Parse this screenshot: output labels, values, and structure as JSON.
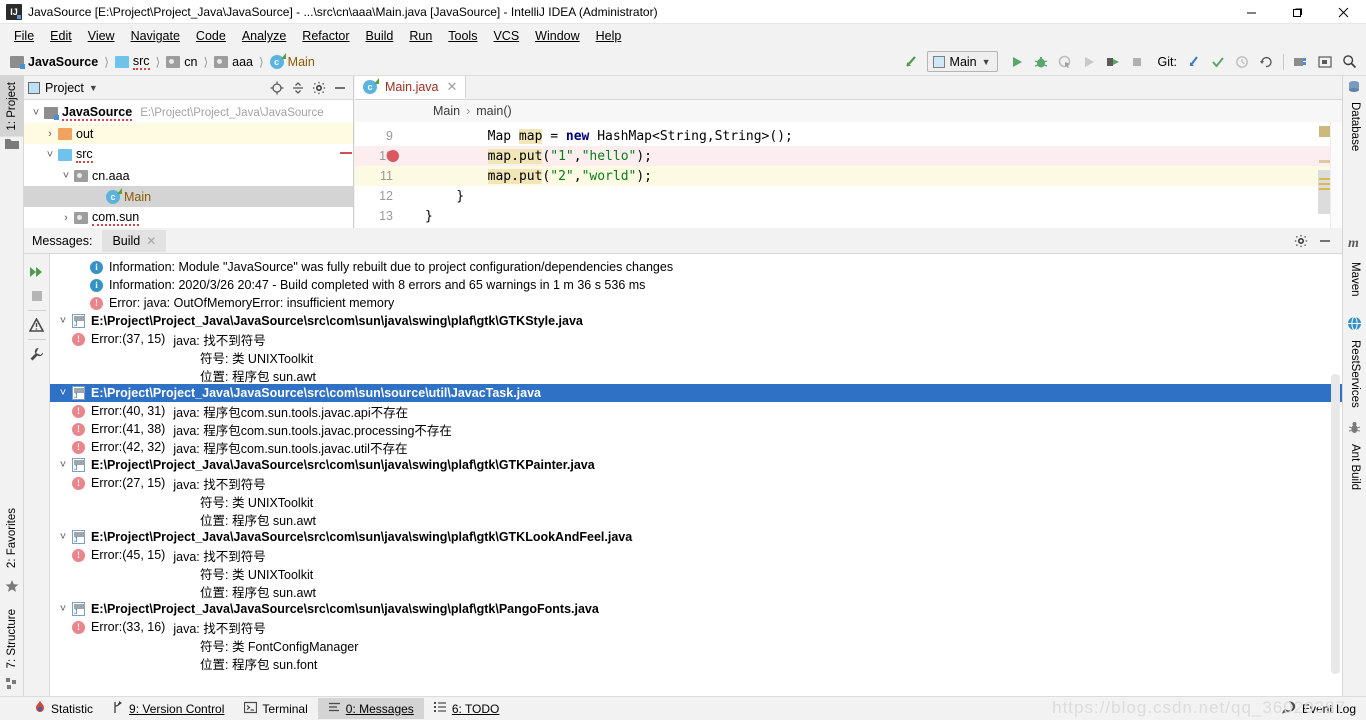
{
  "window": {
    "title": "JavaSource [E:\\Project\\Project_Java\\JavaSource] - ...\\src\\cn\\aaa\\Main.java [JavaSource] - IntelliJ IDEA (Administrator)",
    "app_icon": "IJ",
    "minimize": "minimize-icon",
    "maximize": "restore-icon",
    "close": "close-icon"
  },
  "menu": [
    {
      "label": "File"
    },
    {
      "label": "Edit"
    },
    {
      "label": "View"
    },
    {
      "label": "Navigate"
    },
    {
      "label": "Code"
    },
    {
      "label": "Analyze"
    },
    {
      "label": "Refactor"
    },
    {
      "label": "Build"
    },
    {
      "label": "Run"
    },
    {
      "label": "Tools"
    },
    {
      "label": "VCS"
    },
    {
      "label": "Window"
    },
    {
      "label": "Help"
    }
  ],
  "breadcrumbs": [
    {
      "label": "JavaSource",
      "icon": "module-icon"
    },
    {
      "label": "src",
      "icon": "source-folder-icon"
    },
    {
      "label": "cn",
      "icon": "package-icon"
    },
    {
      "label": "aaa",
      "icon": "package-icon"
    },
    {
      "label": "Main",
      "icon": "class-icon"
    }
  ],
  "toolbar": {
    "run_config": "Main",
    "git_label": "Git:",
    "icons": [
      "build-icon",
      "run-icon",
      "debug-icon",
      "run-coverage-icon",
      "rerun-icon",
      "attach-icon",
      "stop-icon",
      "update-project-icon",
      "commit-icon",
      "history-icon",
      "rollback-icon",
      "project-structure-icon",
      "terminal-icon",
      "search-everywhere-icon"
    ]
  },
  "left_strip": [
    {
      "label": "1: Project",
      "active": true
    },
    {
      "label": "2: Favorites",
      "active": false
    },
    {
      "label": "7: Structure",
      "active": false
    }
  ],
  "right_strip": [
    {
      "label": "Database",
      "icon": "database-icon"
    },
    {
      "label": "Maven",
      "icon": "maven-icon"
    },
    {
      "label": "RestServices",
      "icon": "rest-services-icon"
    },
    {
      "label": "Ant Build",
      "icon": "ant-build-icon"
    }
  ],
  "project_panel": {
    "title": "Project",
    "dropdown": "chevron-down-icon",
    "buttons": [
      "locate-icon",
      "collapse-all-icon",
      "settings-icon",
      "hide-icon"
    ],
    "tree": [
      {
        "label": "JavaSource",
        "path": "E:\\Project\\Project_Java\\JavaSource",
        "twist": "expanded",
        "indent": 0,
        "icon": "module-icon",
        "bold": true,
        "state": "normal"
      },
      {
        "label": "out",
        "path": "",
        "twist": "collapsed",
        "indent": 1,
        "icon": "out-folder-icon",
        "bold": false,
        "state": "highlight"
      },
      {
        "label": "src",
        "path": "",
        "twist": "expanded",
        "indent": 1,
        "icon": "source-folder-icon",
        "bold": false,
        "state": "normal"
      },
      {
        "label": "cn.aaa",
        "path": "",
        "twist": "expanded",
        "indent": 2,
        "icon": "package-icon",
        "bold": false,
        "state": "normal"
      },
      {
        "label": "Main",
        "path": "",
        "twist": "none",
        "indent": 3,
        "icon": "class-icon",
        "bold": false,
        "state": "selected"
      },
      {
        "label": "com.sun",
        "path": "",
        "twist": "collapsed",
        "indent": 2,
        "icon": "package-icon",
        "bold": false,
        "state": "normal"
      }
    ]
  },
  "editor": {
    "tab": {
      "label": "Main.java",
      "icon": "class-icon",
      "close": "close-icon"
    },
    "breadcrumb": [
      "Main",
      "main()"
    ],
    "lines": [
      {
        "num": "9",
        "state": "normal",
        "breakpoint": false,
        "fold": false,
        "segments": [
          {
            "t": "        Map ",
            "c": "plain"
          },
          {
            "t": "map",
            "c": "hl"
          },
          {
            "t": " = ",
            "c": "plain"
          },
          {
            "t": "new",
            "c": "k"
          },
          {
            "t": " HashMap<String,String>();",
            "c": "plain"
          }
        ]
      },
      {
        "num": "10",
        "state": "err",
        "breakpoint": true,
        "fold": false,
        "segments": [
          {
            "t": "        ",
            "c": "plain"
          },
          {
            "t": "map",
            "c": "hl"
          },
          {
            "t": ".",
            "c": "hl"
          },
          {
            "t": "put",
            "c": "hl"
          },
          {
            "t": "(",
            "c": "plain"
          },
          {
            "t": "\"1\"",
            "c": "s"
          },
          {
            "t": ",",
            "c": "plain"
          },
          {
            "t": "\"hello\"",
            "c": "s"
          },
          {
            "t": ");",
            "c": "plain"
          }
        ]
      },
      {
        "num": "11",
        "state": "warnline",
        "breakpoint": false,
        "fold": false,
        "segments": [
          {
            "t": "        ",
            "c": "plain"
          },
          {
            "t": "map",
            "c": "hl"
          },
          {
            "t": ".",
            "c": "hl"
          },
          {
            "t": "put",
            "c": "hl"
          },
          {
            "t": "(",
            "c": "plain"
          },
          {
            "t": "\"2\"",
            "c": "s"
          },
          {
            "t": ",",
            "c": "plain"
          },
          {
            "t": "\"world\"",
            "c": "s"
          },
          {
            "t": ");",
            "c": "plain"
          }
        ]
      },
      {
        "num": "12",
        "state": "normal",
        "breakpoint": false,
        "fold": true,
        "segments": [
          {
            "t": "    }",
            "c": "plain"
          }
        ]
      },
      {
        "num": "13",
        "state": "normal",
        "breakpoint": false,
        "fold": false,
        "segments": [
          {
            "t": "}",
            "c": "plain"
          }
        ]
      }
    ]
  },
  "messages": {
    "label": "Messages:",
    "tab": "Build",
    "tab_close": "close-icon",
    "header_buttons": [
      "settings-icon",
      "hide-icon"
    ],
    "gutter_icons": [
      "expand-all-icon",
      "stop-icon",
      "warnings-filter-icon",
      "settings-wrench-icon"
    ],
    "rows": [
      {
        "kind": "info",
        "indent": 1,
        "twist": "none",
        "text": "Information: Module \"JavaSource\" was fully rebuilt due to project configuration/dependencies changes",
        "selected": false
      },
      {
        "kind": "info",
        "indent": 1,
        "twist": "none",
        "text": "Information: 2020/3/26 20:47 - Build completed with 8 errors and 65 warnings in 1 m 36 s 536 ms",
        "selected": false
      },
      {
        "kind": "error",
        "indent": 1,
        "twist": "none",
        "text": "Error: java: OutOfMemoryError: insufficient memory",
        "selected": false
      },
      {
        "kind": "file",
        "indent": 0,
        "twist": "expanded",
        "text": "E:\\Project\\Project_Java\\JavaSource\\src\\com\\sun\\java\\swing\\plaf\\gtk\\GTKStyle.java",
        "selected": false
      },
      {
        "kind": "error",
        "indent": 2,
        "twist": "none",
        "loc": "Error:(37, 15)",
        "text": "java: 找不到符号",
        "selected": false
      },
      {
        "kind": "detail",
        "indent": 3,
        "twist": "none",
        "text": "符号:   类 UNIXToolkit",
        "selected": false
      },
      {
        "kind": "detail",
        "indent": 3,
        "twist": "none",
        "text": "位置: 程序包 sun.awt",
        "selected": false
      },
      {
        "kind": "file",
        "indent": 0,
        "twist": "expanded",
        "text": "E:\\Project\\Project_Java\\JavaSource\\src\\com\\sun\\source\\util\\JavacTask.java",
        "selected": true
      },
      {
        "kind": "error",
        "indent": 2,
        "twist": "none",
        "loc": "Error:(40, 31)",
        "text": "java: 程序包com.sun.tools.javac.api不存在",
        "selected": false
      },
      {
        "kind": "error",
        "indent": 2,
        "twist": "none",
        "loc": "Error:(41, 38)",
        "text": "java: 程序包com.sun.tools.javac.processing不存在",
        "selected": false
      },
      {
        "kind": "error",
        "indent": 2,
        "twist": "none",
        "loc": "Error:(42, 32)",
        "text": "java: 程序包com.sun.tools.javac.util不存在",
        "selected": false
      },
      {
        "kind": "file",
        "indent": 0,
        "twist": "expanded",
        "text": "E:\\Project\\Project_Java\\JavaSource\\src\\com\\sun\\java\\swing\\plaf\\gtk\\GTKPainter.java",
        "selected": false
      },
      {
        "kind": "error",
        "indent": 2,
        "twist": "none",
        "loc": "Error:(27, 15)",
        "text": "java: 找不到符号",
        "selected": false
      },
      {
        "kind": "detail",
        "indent": 3,
        "twist": "none",
        "text": "符号:   类 UNIXToolkit",
        "selected": false
      },
      {
        "kind": "detail",
        "indent": 3,
        "twist": "none",
        "text": "位置: 程序包 sun.awt",
        "selected": false
      },
      {
        "kind": "file",
        "indent": 0,
        "twist": "expanded",
        "text": "E:\\Project\\Project_Java\\JavaSource\\src\\com\\sun\\java\\swing\\plaf\\gtk\\GTKLookAndFeel.java",
        "selected": false
      },
      {
        "kind": "error",
        "indent": 2,
        "twist": "none",
        "loc": "Error:(45, 15)",
        "text": "java: 找不到符号",
        "selected": false
      },
      {
        "kind": "detail",
        "indent": 3,
        "twist": "none",
        "text": "符号:   类 UNIXToolkit",
        "selected": false
      },
      {
        "kind": "detail",
        "indent": 3,
        "twist": "none",
        "text": "位置: 程序包 sun.awt",
        "selected": false
      },
      {
        "kind": "file",
        "indent": 0,
        "twist": "expanded",
        "text": "E:\\Project\\Project_Java\\JavaSource\\src\\com\\sun\\java\\swing\\plaf\\gtk\\PangoFonts.java",
        "selected": false
      },
      {
        "kind": "error",
        "indent": 2,
        "twist": "none",
        "loc": "Error:(33, 16)",
        "text": "java: 找不到符号",
        "selected": false
      },
      {
        "kind": "detail",
        "indent": 3,
        "twist": "none",
        "text": "符号:   类 FontConfigManager",
        "selected": false
      },
      {
        "kind": "detail",
        "indent": 3,
        "twist": "none",
        "text": "位置: 程序包 sun.font",
        "selected": false
      }
    ]
  },
  "statusbar": {
    "items": [
      {
        "label": "Statistic",
        "icon": "statistic-icon",
        "active": false
      },
      {
        "label": "9: Version Control",
        "icon": "vcs-icon",
        "active": false
      },
      {
        "label": "Terminal",
        "icon": "terminal-icon",
        "active": false
      },
      {
        "label": "0: Messages",
        "icon": "messages-icon",
        "active": true
      },
      {
        "label": "6: TODO",
        "icon": "todo-icon",
        "active": false
      }
    ],
    "event_log": "Event Log",
    "event_log_icon": "event-log-icon"
  },
  "watermark": "https://blog.csdn.net/qq_36020387",
  "colors": {
    "selection_blue": "#2f71c4",
    "error_red": "#e8868c",
    "info_blue": "#3592c4",
    "breakpoint_red": "#db5860",
    "highlight_yellow": "#fffbe2",
    "string_green": "#067d17",
    "keyword_navy": "#000080"
  }
}
